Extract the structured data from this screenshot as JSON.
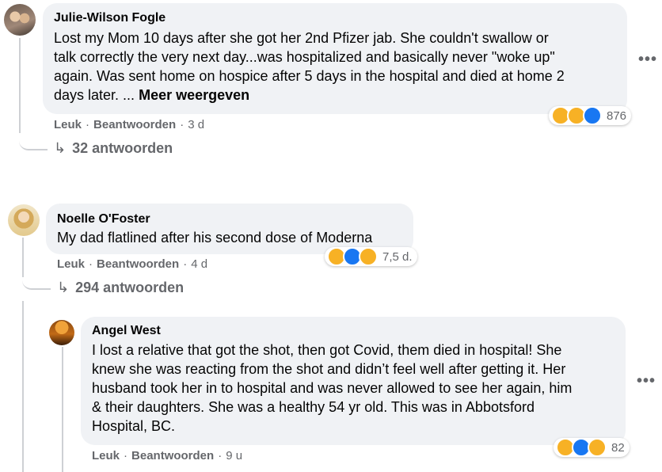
{
  "comments": [
    {
      "author": "Julie-Wilson Fogle",
      "lines": [
        "Lost my Mom 10 days after she got her 2nd Pfizer jab. She couldn't swallow or",
        "talk correctly the very next day...was hospitalized and basically never \"woke up\"",
        "again. Was sent home on hospice after 5 days in the hospital and died at home 2",
        "days later. ..."
      ],
      "more_label": "Meer weergeven",
      "like_label": "Leuk",
      "reply_label": "Beantwoorden",
      "time": "3 d",
      "reaction_count": "876",
      "replies_label": "32 antwoorden"
    },
    {
      "author": "Noelle O'Foster",
      "lines": [
        "My dad flatlined after his second dose of Moderna"
      ],
      "like_label": "Leuk",
      "reply_label": "Beantwoorden",
      "time": "4 d",
      "reaction_count": "7,5 d.",
      "replies_label": "294 antwoorden"
    },
    {
      "author": "Angel West",
      "lines": [
        "I lost a relative that got the shot, then got Covid, them died in hospital! She",
        "knew she was reacting from the shot and didn’t feel well after getting it. Her",
        "husband took her in to hospital and was never allowed to see her again, him",
        "& their daughters. She was a healthy 54 yr old. This was in Abbotsford",
        "Hospital, BC."
      ],
      "like_label": "Leuk",
      "reply_label": "Beantwoorden",
      "time": "9 u",
      "reaction_count": "82"
    }
  ],
  "icons": {
    "more": "more-horizontal-icon",
    "reply_arrow": "reply-arrow-icon"
  },
  "glyphs": {
    "more_dots": "•••",
    "reply_arrow": "↳",
    "separator": "·"
  },
  "colors": {
    "bubble": "#f0f2f5",
    "meta": "#65676b",
    "like_blue": "#1877f2",
    "emoji_yellow": "#f7b125"
  }
}
